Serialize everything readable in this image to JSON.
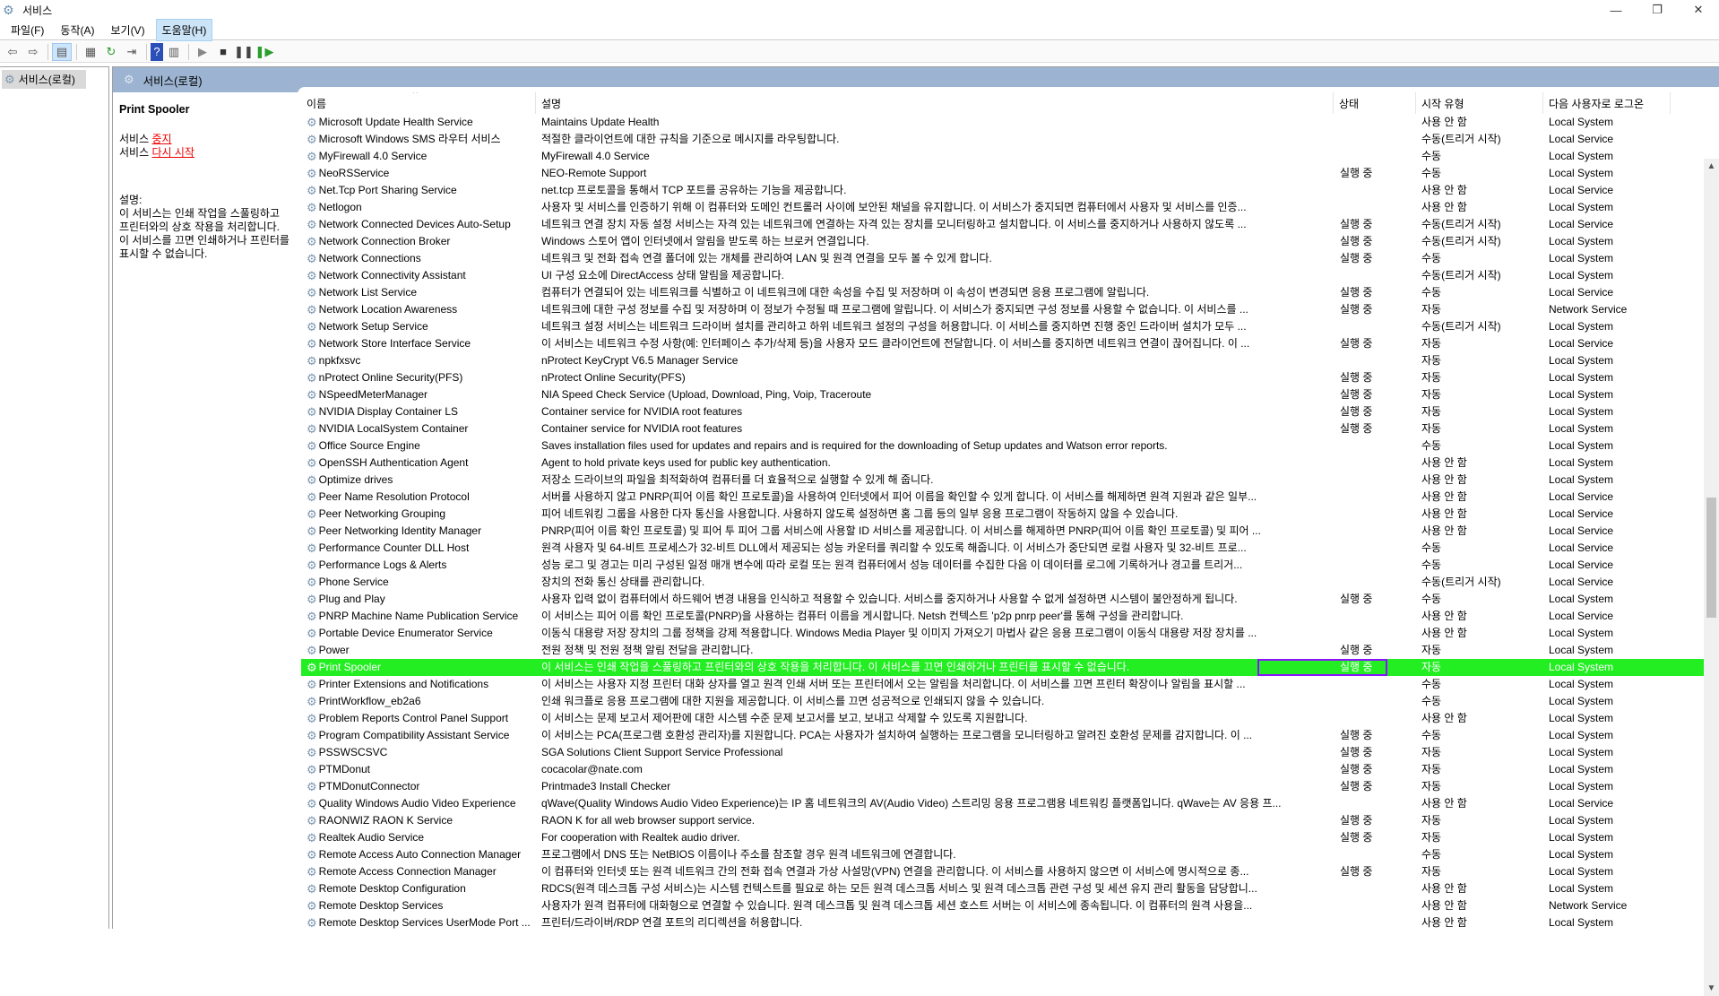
{
  "window": {
    "title": "서비스",
    "minimize": "—",
    "maximize": "❐",
    "close": "✕"
  },
  "menu": [
    "파일(F)",
    "동작(A)",
    "보기(V)",
    "도움말(H)"
  ],
  "tree": {
    "item": "서비스(로컬)"
  },
  "panel": {
    "title": "서비스(로컬)"
  },
  "ext": {
    "service_name": "Print Spooler",
    "stop_prefix": "서비스 ",
    "stop_link": "중지",
    "restart_prefix": "서비스 ",
    "restart_link": "다시 시작",
    "desc_label": "설명:",
    "description": "이 서비스는 인쇄 작업을 스풀링하고 프린터와의 상호 작용을 처리합니다. 이 서비스를 끄면 인쇄하거나 프린터를 표시할 수 없습니다."
  },
  "columns": {
    "name": "이름",
    "desc": "설명",
    "status": "상태",
    "start": "시작 유형",
    "logon": "다음 사용자로 로그온"
  },
  "colors": {
    "selected": "#22ee22",
    "focus": "#8a12ff"
  },
  "selected_index": 32,
  "rows": [
    [
      "Microsoft Update Health Service",
      "Maintains Update Health",
      "",
      "사용 안 함",
      "Local System"
    ],
    [
      "Microsoft Windows SMS 라우터 서비스",
      "적절한 클라이언트에 대한 규칙을 기준으로 메시지를 라우팅합니다.",
      "",
      "수동(트리거 시작)",
      "Local Service"
    ],
    [
      "MyFirewall 4.0 Service",
      "MyFirewall 4.0 Service",
      "",
      "수동",
      "Local System"
    ],
    [
      "NeoRSService",
      "NEO-Remote Support",
      "실행 중",
      "수동",
      "Local System"
    ],
    [
      "Net.Tcp Port Sharing Service",
      "net.tcp 프로토콜을 통해서 TCP 포트를 공유하는 기능을 제공합니다.",
      "",
      "사용 안 함",
      "Local Service"
    ],
    [
      "Netlogon",
      "사용자 및 서비스를 인증하기 위해 이 컴퓨터와 도메인 컨트롤러 사이에 보안된 채널을 유지합니다. 이 서비스가 중지되면 컴퓨터에서 사용자 및 서비스를 인증...",
      "",
      "사용 안 함",
      "Local System"
    ],
    [
      "Network Connected Devices Auto-Setup",
      "네트워크 연결 장치 자동 설정 서비스는 자격 있는 네트워크에 연결하는 자격 있는 장치를 모니터링하고 설치합니다. 이 서비스를 중지하거나 사용하지 않도록 ...",
      "실행 중",
      "수동(트리거 시작)",
      "Local Service"
    ],
    [
      "Network Connection Broker",
      "Windows 스토어 앱이 인터넷에서 알림을 받도록 하는 브로커 연결입니다.",
      "실행 중",
      "수동(트리거 시작)",
      "Local System"
    ],
    [
      "Network Connections",
      "네트워크 및 전화 접속 연결 폴더에 있는 개체를 관리하여 LAN 및 원격 연결을 모두 볼 수 있게 합니다.",
      "실행 중",
      "수동",
      "Local System"
    ],
    [
      "Network Connectivity Assistant",
      "UI 구성 요소에 DirectAccess 상태 알림을 제공합니다.",
      "",
      "수동(트리거 시작)",
      "Local System"
    ],
    [
      "Network List Service",
      "컴퓨터가 연결되어 있는 네트워크를 식별하고 이 네트워크에 대한 속성을 수집 및 저장하며 이 속성이 변경되면 응용 프로그램에 알립니다.",
      "실행 중",
      "수동",
      "Local Service"
    ],
    [
      "Network Location Awareness",
      "네트워크에 대한 구성 정보를 수집 및 저장하며 이 정보가 수정될 때 프로그램에 알립니다. 이 서비스가 중지되면 구성 정보를 사용할 수 없습니다. 이 서비스를 ...",
      "실행 중",
      "자동",
      "Network Service"
    ],
    [
      "Network Setup Service",
      "네트워크 설정 서비스는 네트워크 드라이버 설치를 관리하고 하위 네트워크 설정의 구성을 허용합니다. 이 서비스를 중지하면 진행 중인 드라이버 설치가 모두 ...",
      "",
      "수동(트리거 시작)",
      "Local System"
    ],
    [
      "Network Store Interface Service",
      "이 서비스는 네트워크 수정 사항(예: 인터페이스 추가/삭제 등)을 사용자 모드 클라이언트에 전달합니다. 이 서비스를 중지하면 네트워크 연결이 끊어집니다. 이 ...",
      "실행 중",
      "자동",
      "Local Service"
    ],
    [
      "npkfxsvc",
      "nProtect KeyCrypt V6.5 Manager Service",
      "",
      "자동",
      "Local System"
    ],
    [
      "nProtect Online Security(PFS)",
      "nProtect Online Security(PFS)",
      "실행 중",
      "자동",
      "Local System"
    ],
    [
      "NSpeedMeterManager",
      "NIA Speed Check Service (Upload, Download, Ping, Voip, Traceroute",
      "실행 중",
      "자동",
      "Local System"
    ],
    [
      "NVIDIA Display Container LS",
      "Container service for NVIDIA root features",
      "실행 중",
      "자동",
      "Local System"
    ],
    [
      "NVIDIA LocalSystem Container",
      "Container service for NVIDIA root features",
      "실행 중",
      "자동",
      "Local System"
    ],
    [
      "Office  Source Engine",
      "Saves installation files used for updates and repairs and is required for the downloading of Setup updates and Watson error reports.",
      "",
      "수동",
      "Local System"
    ],
    [
      "OpenSSH Authentication Agent",
      "Agent to hold private keys used for public key authentication.",
      "",
      "사용 안 함",
      "Local System"
    ],
    [
      "Optimize drives",
      "저장소 드라이브의 파일을 최적화하여 컴퓨터를 더 효율적으로 실행할 수 있게 해 줍니다.",
      "",
      "사용 안 함",
      "Local System"
    ],
    [
      "Peer Name Resolution Protocol",
      "서버를 사용하지 않고 PNRP(피어 이름 확인 프로토콜)을 사용하여 인터넷에서 피어 이름을 확인할 수 있게 합니다. 이 서비스를 해제하면 원격 지원과 같은 일부...",
      "",
      "사용 안 함",
      "Local Service"
    ],
    [
      "Peer Networking Grouping",
      "피어 네트워킹 그룹을 사용한 다자 통신을 사용합니다. 사용하지 않도록 설정하면 홈 그룹 등의 일부 응용 프로그램이 작동하지 않을 수 있습니다.",
      "",
      "사용 안 함",
      "Local Service"
    ],
    [
      "Peer Networking Identity Manager",
      "PNRP(피어 이름 확인 프로토콜) 및 피어 투 피어 그룹 서비스에 사용할 ID 서비스를 제공합니다. 이 서비스를 해제하면 PNRP(피어 이름 확인 프로토콜) 및 피어 ...",
      "",
      "사용 안 함",
      "Local Service"
    ],
    [
      "Performance Counter DLL Host",
      "원격 사용자 및 64-비트 프로세스가 32-비트 DLL에서 제공되는 성능 카운터를 쿼리할 수 있도록 해줍니다. 이 서비스가 중단되면 로컬 사용자 및 32-비트 프로...",
      "",
      "수동",
      "Local Service"
    ],
    [
      "Performance Logs & Alerts",
      "성능 로그 및 경고는 미리 구성된 일정 매개 변수에 따라 로컬 또는 원격 컴퓨터에서 성능 데이터를 수집한 다음 이 데이터를 로그에 기록하거나 경고를 트리거...",
      "",
      "수동",
      "Local Service"
    ],
    [
      "Phone Service",
      "장치의 전화 통신 상태를 관리합니다.",
      "",
      "수동(트리거 시작)",
      "Local Service"
    ],
    [
      "Plug and Play",
      "사용자 입력 없이 컴퓨터에서 하드웨어 변경 내용을 인식하고 적용할 수 있습니다. 서비스를 중지하거나 사용할 수 없게 설정하면 시스템이 불안정하게 됩니다.",
      "실행 중",
      "수동",
      "Local System"
    ],
    [
      "PNRP Machine Name Publication Service",
      "이 서비스는 피어 이름 확인 프로토콜(PNRP)을 사용하는 컴퓨터 이름을 게시합니다. Netsh 컨텍스트 'p2p pnrp peer'를 통해 구성을 관리합니다.",
      "",
      "사용 안 함",
      "Local Service"
    ],
    [
      "Portable Device Enumerator Service",
      "이동식 대용량 저장 장치의 그룹 정책을 강제 적용합니다. Windows Media Player 및 이미지 가져오기 마법사 같은 응용 프로그램이 이동식 대용량 저장 장치를 ...",
      "",
      "사용 안 함",
      "Local System"
    ],
    [
      "Power",
      "전원 정책 및 전원 정책 알림 전달을 관리합니다.",
      "실행 중",
      "자동",
      "Local System"
    ],
    [
      "Print Spooler",
      "이 서비스는 인쇄 작업을 스풀링하고 프린터와의 상호 작용을 처리합니다. 이 서비스를 끄면 인쇄하거나 프린터를 표시할 수 없습니다.",
      "실행 중",
      "자동",
      "Local System"
    ],
    [
      "Printer Extensions and Notifications",
      "이 서비스는 사용자 지정 프린터 대화 상자를 열고 원격 인쇄 서버 또는 프린터에서 오는 알림을 처리합니다. 이 서비스를 끄면 프린터 확장이나 알림을 표시할 ...",
      "",
      "수동",
      "Local System"
    ],
    [
      "PrintWorkflow_eb2a6",
      "인쇄 워크플로 응용 프로그램에 대한 지원을 제공합니다. 이 서비스를 끄면 성공적으로 인쇄되지 않을 수 있습니다.",
      "",
      "수동",
      "Local System"
    ],
    [
      "Problem Reports Control Panel Support",
      "이 서비스는 문제 보고서 제어판에 대한 시스템 수준 문제 보고서를 보고, 보내고 삭제할 수 있도록 지원합니다.",
      "",
      "사용 안 함",
      "Local System"
    ],
    [
      "Program Compatibility Assistant Service",
      "이 서비스는 PCA(프로그램 호환성 관리자)를 지원합니다. PCA는 사용자가 설치하여 실행하는 프로그램을 모니터링하고 알려진 호환성 문제를 감지합니다. 이 ...",
      "실행 중",
      "수동",
      "Local System"
    ],
    [
      "PSSWSCSVC",
      "SGA Solutions Client Support Service Professional",
      "실행 중",
      "자동",
      "Local System"
    ],
    [
      "PTMDonut",
      "cocacolar@nate.com",
      "실행 중",
      "자동",
      "Local System"
    ],
    [
      "PTMDonutConnector",
      "Printmade3 Install Checker",
      "실행 중",
      "자동",
      "Local System"
    ],
    [
      "Quality Windows Audio Video Experience",
      "qWave(Quality Windows Audio Video Experience)는 IP 홈 네트워크의 AV(Audio Video) 스트리밍 응용 프로그램용 네트워킹 플랫폼입니다. qWave는 AV 응용 프...",
      "",
      "사용 안 함",
      "Local Service"
    ],
    [
      "RAONWIZ RAON K Service",
      "RAON K for all web browser support service.",
      "실행 중",
      "자동",
      "Local System"
    ],
    [
      "Realtek Audio Service",
      "For cooperation with Realtek audio driver.",
      "실행 중",
      "자동",
      "Local System"
    ],
    [
      "Remote Access Auto Connection Manager",
      "프로그램에서 DNS 또는 NetBIOS 이름이나 주소를 참조할 경우 원격 네트워크에 연결합니다.",
      "",
      "수동",
      "Local System"
    ],
    [
      "Remote Access Connection Manager",
      "이 컴퓨터와 인터넷 또는 원격 네트워크 간의 전화 접속 연결과 가상 사설망(VPN) 연결을 관리합니다. 이 서비스를 사용하지 않으면 이 서비스에 명시적으로 종...",
      "실행 중",
      "자동",
      "Local System"
    ],
    [
      "Remote Desktop Configuration",
      "RDCS(원격 데스크톱 구성 서비스)는 시스템 컨텍스트를 필요로 하는 모든 원격 데스크톱 서비스 및 원격 데스크톱 관련 구성 및 세션 유지 관리 활동을 담당합니...",
      "",
      "사용 안 함",
      "Local System"
    ],
    [
      "Remote Desktop Services",
      "사용자가 원격 컴퓨터에 대화형으로 연결할 수 있습니다. 원격 데스크톱 및 원격 데스크톱 세션 호스트 서버는 이 서비스에 종속됩니다. 이 컴퓨터의 원격 사용을...",
      "",
      "사용 안 함",
      "Network Service"
    ],
    [
      "Remote Desktop Services UserMode Port ...",
      "프린터/드라이버/RDP 연결 포트의 리디렉션을 허용합니다.",
      "",
      "사용 안 함",
      "Local System"
    ]
  ]
}
